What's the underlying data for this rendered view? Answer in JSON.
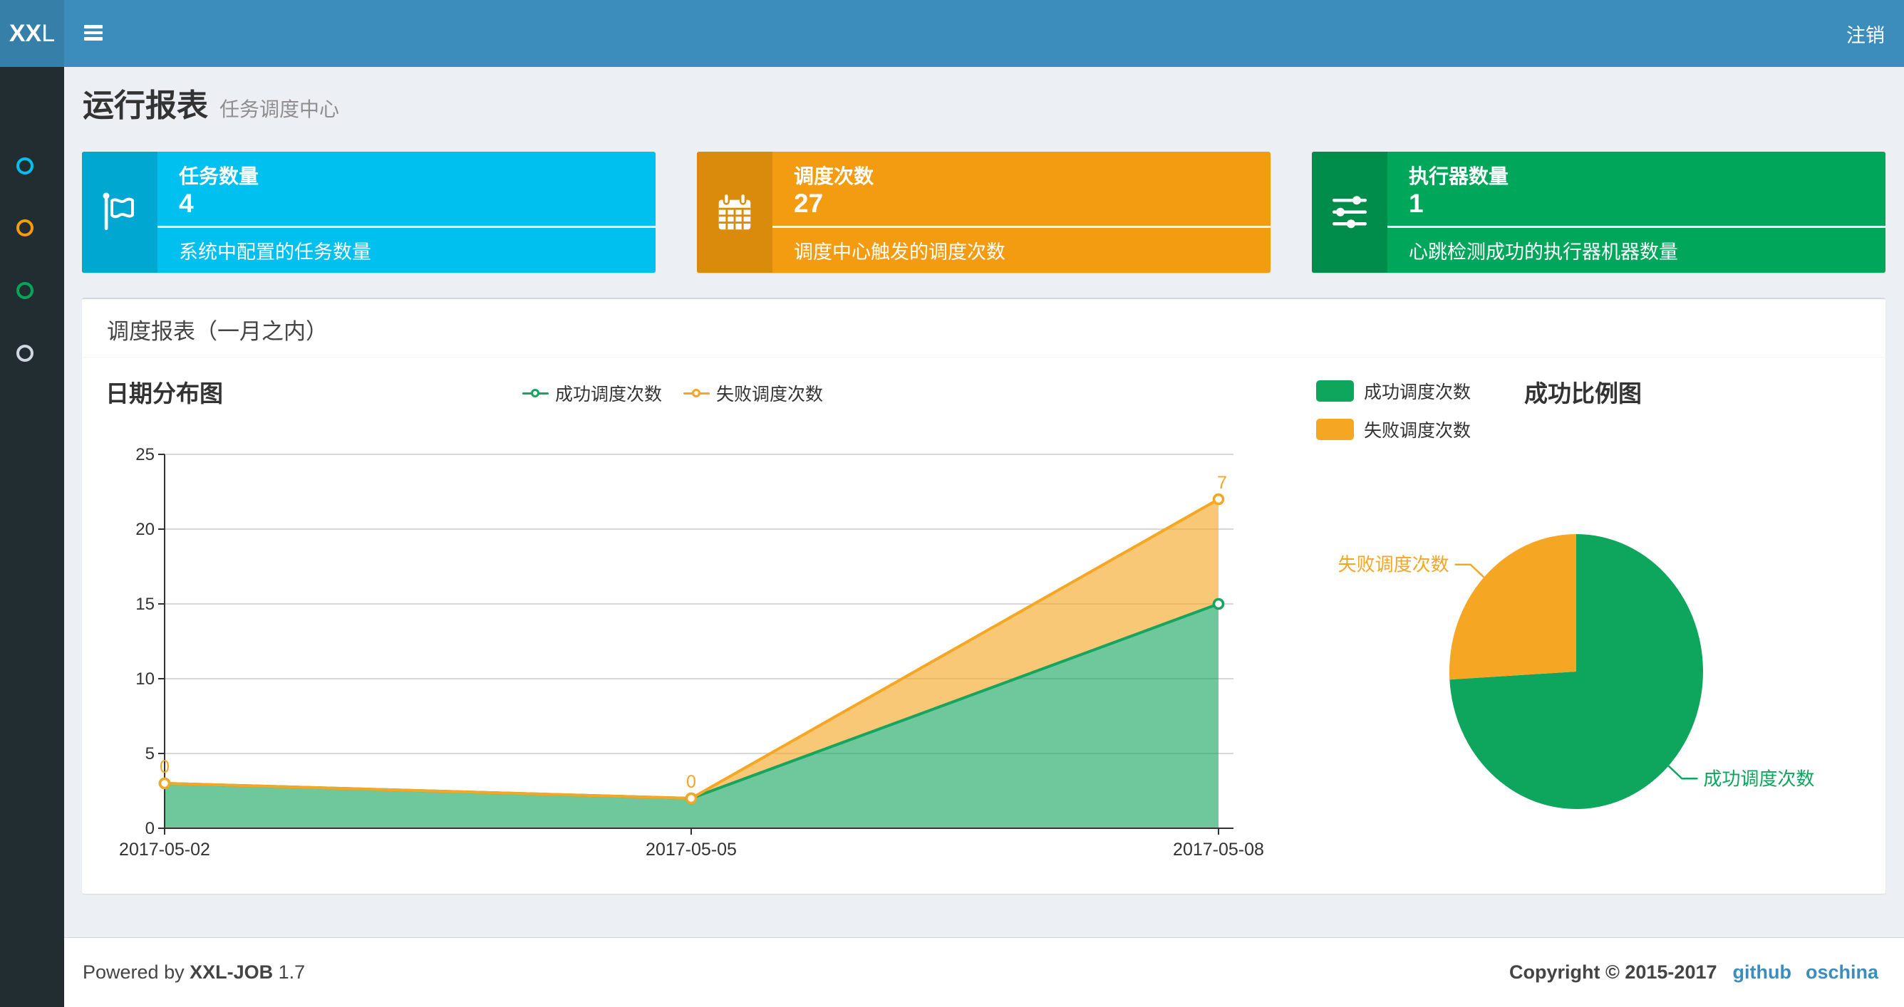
{
  "header": {
    "logo_bold": "XX",
    "logo_light": "L",
    "logout_label": "注销"
  },
  "colors": {
    "header_bg": "#3c8dbc",
    "logo_bg": "#367fa9",
    "sidebar_bg": "#222d32",
    "content_bg": "#ecf0f5",
    "link": "#3c8dbc"
  },
  "sidebar": {
    "items": [
      {
        "name": "report",
        "color": "#00c0ef"
      },
      {
        "name": "job-manage",
        "color": "#f39c12"
      },
      {
        "name": "job-log",
        "color": "#00a65a"
      },
      {
        "name": "help",
        "color": "#d2d6de"
      }
    ]
  },
  "page": {
    "title": "运行报表",
    "subtitle": "任务调度中心"
  },
  "cards": [
    {
      "title": "任务数量",
      "value": "4",
      "desc": "系统中配置的任务数量",
      "bg": "#00c0ef",
      "icon_bg": "#00a7d0",
      "icon": "flag-icon"
    },
    {
      "title": "调度次数",
      "value": "27",
      "desc": "调度中心触发的调度次数",
      "bg": "#f39c12",
      "icon_bg": "#db8b0b",
      "icon": "calendar-icon"
    },
    {
      "title": "执行器数量",
      "value": "1",
      "desc": "心跳检测成功的执行器机器数量",
      "bg": "#00a65a",
      "icon_bg": "#008d4c",
      "icon": "sliders-icon"
    }
  ],
  "panel": {
    "title": "调度报表（一月之内）"
  },
  "footer": {
    "powered_prefix": "Powered by",
    "brand": "XXL-JOB",
    "version": "1.7",
    "copyright": "Copyright © 2015-2017",
    "links": [
      "github",
      "oschina"
    ]
  },
  "chart_data": [
    {
      "type": "area",
      "title": "日期分布图",
      "x": [
        "2017-05-02",
        "2017-05-05",
        "2017-05-08"
      ],
      "stacked": true,
      "series": [
        {
          "name": "成功调度次数",
          "values": [
            3,
            2,
            15
          ],
          "color": "#17a45f",
          "fill": "rgba(23,164,95,0.62)"
        },
        {
          "name": "失败调度次数",
          "values": [
            0,
            0,
            7
          ],
          "color": "#f5a623",
          "fill": "rgba(245,166,35,0.62)",
          "data_labels": [
            "0",
            "0",
            "7"
          ]
        }
      ],
      "ylim": [
        0,
        25
      ],
      "yticks": [
        0,
        5,
        10,
        15,
        20,
        25
      ],
      "grid": true,
      "legend_position": "top-center"
    },
    {
      "type": "pie",
      "title": "成功比例图",
      "slices": [
        {
          "label": "成功调度次数",
          "value": 20,
          "color": "#0ea55c"
        },
        {
          "label": "失败调度次数",
          "value": 7,
          "color": "#f5a623"
        }
      ],
      "start_angle_deg": 90,
      "clockwise": true,
      "legend_position": "top-left"
    }
  ]
}
